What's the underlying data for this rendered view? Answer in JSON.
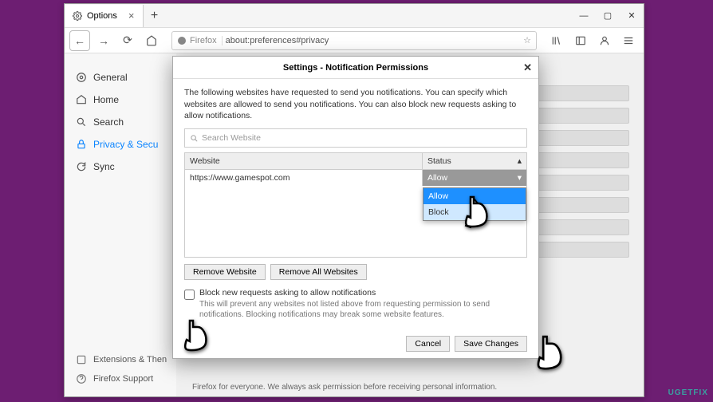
{
  "window": {
    "tab_title": "Options",
    "identity_label": "Firefox",
    "url": "about:preferences#privacy"
  },
  "sidebar": {
    "items": [
      {
        "label": "General"
      },
      {
        "label": "Home"
      },
      {
        "label": "Search"
      },
      {
        "label": "Privacy & Secu"
      },
      {
        "label": "Sync"
      }
    ],
    "footer": [
      {
        "label": "Extensions & Then"
      },
      {
        "label": "Firefox Support"
      }
    ]
  },
  "dialog": {
    "title": "Settings - Notification Permissions",
    "description": "The following websites have requested to send you notifications. You can specify which websites are allowed to send you notifications. You can also block new requests asking to allow notifications.",
    "search_placeholder": "Search Website",
    "col_website": "Website",
    "col_status": "Status",
    "row_site": "https://www.gamespot.com",
    "row_status": "Allow",
    "options": {
      "allow": "Allow",
      "block": "Block"
    },
    "remove_btn": "Remove Website",
    "remove_all_btn": "Remove All Websites",
    "block_new_label": "Block new requests asking to allow notifications",
    "block_new_sub": "This will prevent any websites not listed above from requesting permission to send notifications. Blocking notifications may break some website features.",
    "cancel": "Cancel",
    "save": "Save Changes"
  },
  "page_footer_text": "Firefox for everyone. We always ask permission before receiving personal information.",
  "watermark": "UGETFIX"
}
